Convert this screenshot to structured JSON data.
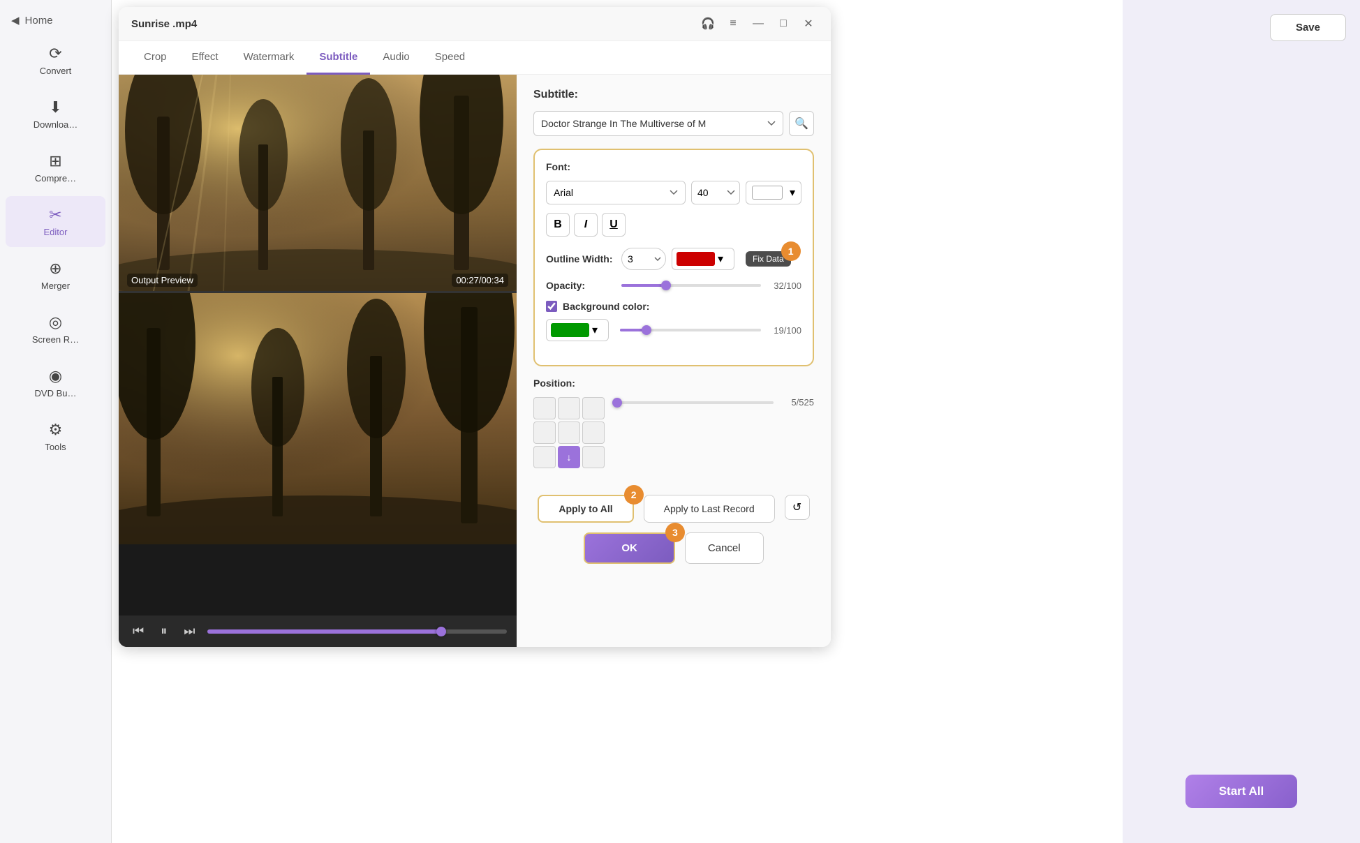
{
  "app": {
    "title": "Sunrise .mp4"
  },
  "sidebar": {
    "back_label": "Home",
    "items": [
      {
        "id": "convert",
        "label": "Convert",
        "icon": "⟳"
      },
      {
        "id": "download",
        "label": "Download",
        "icon": "⬇"
      },
      {
        "id": "compress",
        "label": "Compress",
        "icon": "⊞"
      },
      {
        "id": "editor",
        "label": "Editor",
        "icon": "✂",
        "active": true
      },
      {
        "id": "merger",
        "label": "Merger",
        "icon": "⊕"
      },
      {
        "id": "screen",
        "label": "Screen R…",
        "icon": "◎"
      },
      {
        "id": "dvd",
        "label": "DVD Bu…",
        "icon": "◉"
      },
      {
        "id": "tools",
        "label": "Tools",
        "icon": "⚙"
      }
    ]
  },
  "dialog": {
    "title": "Sunrise .mp4",
    "tabs": [
      "Crop",
      "Effect",
      "Watermark",
      "Subtitle",
      "Audio",
      "Speed"
    ],
    "active_tab": "Subtitle",
    "preview_label": "Output Preview",
    "preview_time": "00:27/00:34",
    "progress_percent": 78
  },
  "subtitle_panel": {
    "label": "Subtitle:",
    "subtitle_value": "Doctor Strange In The Multiverse of M",
    "font_section": "Font:",
    "font_face": "Arial",
    "font_size": "40",
    "font_color": "#ffffff",
    "bold_label": "B",
    "italic_label": "I",
    "underline_label": "U",
    "outline_label": "Outline Width:",
    "outline_value": "3",
    "outline_color": "#cc0000",
    "tooltip_text": "Fix Data",
    "opacity_label": "Opacity:",
    "opacity_value": "32/100",
    "opacity_percent": 32,
    "bg_color_label": "Background color:",
    "bg_color_checked": true,
    "bg_color": "#009900",
    "bg_opacity_value": "19/100",
    "bg_opacity_percent": 19,
    "position_label": "Position:",
    "position_slider_value": "5/525",
    "buttons": {
      "apply_all": "Apply to All",
      "apply_last": "Apply to Last Record",
      "refresh_icon": "↺",
      "ok": "OK",
      "cancel": "Cancel"
    },
    "step_badges": [
      "1",
      "2",
      "3"
    ]
  },
  "right_panel": {
    "save_label": "Save",
    "start_all_label": "Start All"
  }
}
